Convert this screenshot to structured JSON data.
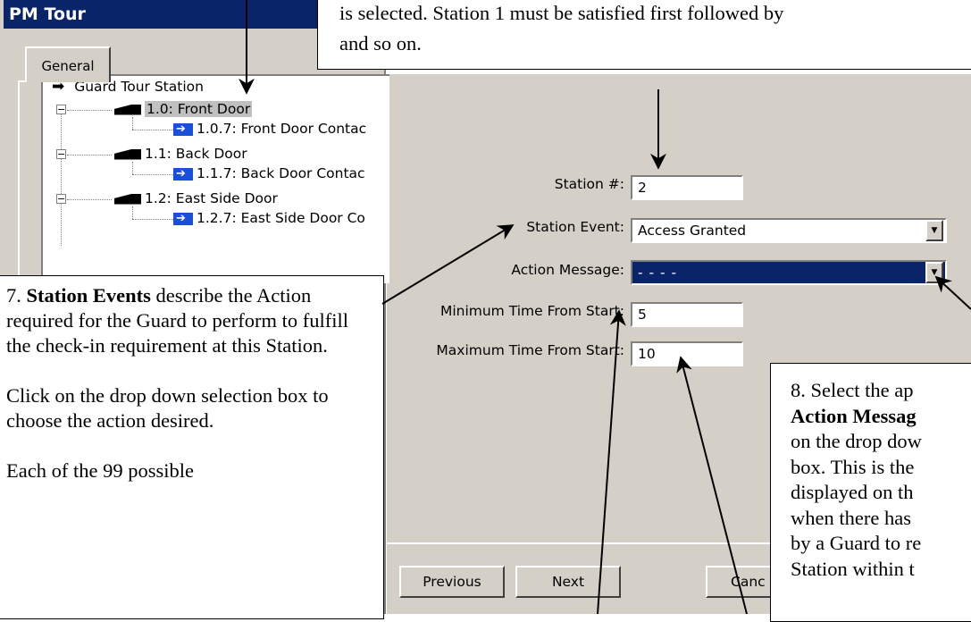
{
  "window": {
    "title": "PM Tour",
    "tab_general": "General"
  },
  "tree": {
    "root": "Guard Tour Station",
    "stations": [
      {
        "label": "1.0: Front Door",
        "input": "1.0.7: Front Door Contac"
      },
      {
        "label": "1.1: Back Door",
        "input": "1.1.7: Back Door Contac"
      },
      {
        "label": "1.2: East Side Door",
        "input": "1.2.7: East Side Door Co"
      }
    ]
  },
  "form": {
    "station_no_label": "Station #:",
    "station_no_value": "2",
    "station_event_label": "Station Event:",
    "station_event_value": "Access Granted",
    "action_message_label": "Action Message:",
    "action_message_value": "- - - -",
    "min_time_label": "Minimum Time From Start:",
    "min_time_value": "5",
    "max_time_label": "Maximum Time From Start:",
    "max_time_value": "10"
  },
  "buttons": {
    "previous": "Previous",
    "next": "Next",
    "cancel": "Canc"
  },
  "callouts": {
    "top_line1": "is selected. Station 1 must be satisfied first followed by",
    "top_line2": "and so on.",
    "left_num": "7.",
    "left_bold": "Station Events",
    "left_rest": " describe the Action required for the Guard to perform to fulfill the check-in requirement at this Station.",
    "left_p2": "Click on the drop down selection box to choose the action desired.",
    "left_p3": "Each of the 99 possible",
    "right_num": "8. Select the ap",
    "right_bold": "Action Messag",
    "right_l3": "on the drop dow",
    "right_l4": "box. This is the",
    "right_l5": "displayed on th",
    "right_l6": "when there has",
    "right_l7": "by a Guard to re",
    "right_l8": "Station within t"
  },
  "colors": {
    "title_bar": "#0a246a",
    "dialog_face": "#d4d0c8",
    "selection": "#0a246a"
  }
}
